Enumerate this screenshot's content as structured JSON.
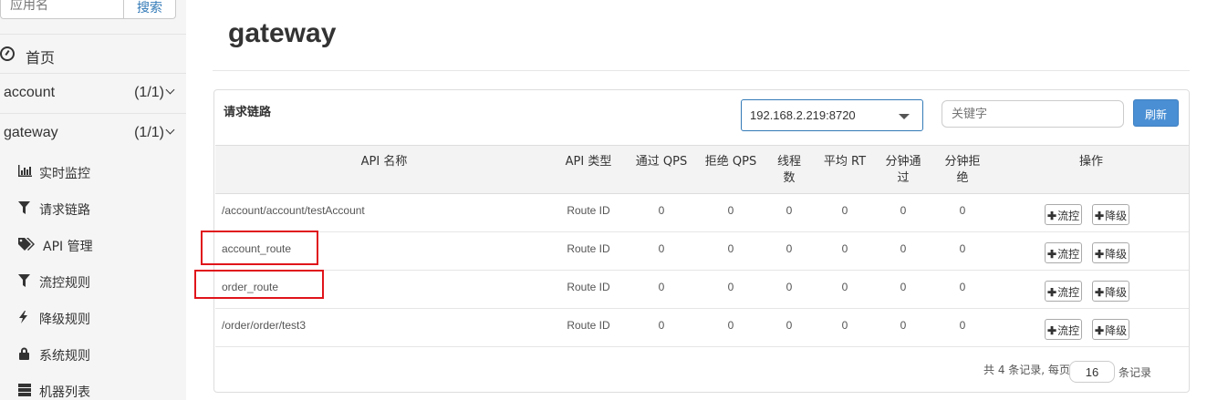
{
  "sidebar": {
    "search": {
      "placeholder": "应用名",
      "button": "搜索"
    },
    "home": {
      "label": "首页",
      "icon": "dashboard-icon"
    },
    "apps": [
      {
        "name": "account",
        "count": "(1/1)"
      },
      {
        "name": "gateway",
        "count": "(1/1)"
      }
    ],
    "sub_items": [
      {
        "label": "实时监控",
        "icon": "bar-chart-icon"
      },
      {
        "label": "请求链路",
        "icon": "filter-icon"
      },
      {
        "label": "API 管理",
        "icon": "tags-icon"
      },
      {
        "label": "流控规则",
        "icon": "filter-icon"
      },
      {
        "label": "降级规则",
        "icon": "flash-icon"
      },
      {
        "label": "系统规则",
        "icon": "lock-icon"
      },
      {
        "label": "机器列表",
        "icon": "server-icon"
      }
    ]
  },
  "main": {
    "title": "gateway",
    "panel": {
      "title": "请求链路",
      "ip_select": "192.168.2.219:8720",
      "keyword_placeholder": "关键字",
      "refresh": "刷新"
    },
    "table": {
      "headers": {
        "api_name": "API 名称",
        "api_type": "API 类型",
        "pass_qps": "通过 QPS",
        "block_qps": "拒绝 QPS",
        "threads_1": "线程",
        "threads_2": "数",
        "avg_rt": "平均 RT",
        "min_pass_1": "分钟通",
        "min_pass_2": "过",
        "min_block_1": "分钟拒",
        "min_block_2": "绝",
        "ops": "操作"
      },
      "rows": [
        {
          "name": "/account/account/testAccount",
          "type": "Route ID",
          "pass_qps": "0",
          "block_qps": "0",
          "threads": "0",
          "avg_rt": "0",
          "min_pass": "0",
          "min_block": "0"
        },
        {
          "name": "account_route",
          "type": "Route ID",
          "pass_qps": "0",
          "block_qps": "0",
          "threads": "0",
          "avg_rt": "0",
          "min_pass": "0",
          "min_block": "0"
        },
        {
          "name": "order_route",
          "type": "Route ID",
          "pass_qps": "0",
          "block_qps": "0",
          "threads": "0",
          "avg_rt": "0",
          "min_pass": "0",
          "min_block": "0"
        },
        {
          "name": "/order/order/test3",
          "type": "Route ID",
          "pass_qps": "0",
          "block_qps": "0",
          "threads": "0",
          "avg_rt": "0",
          "min_pass": "0",
          "min_block": "0"
        }
      ],
      "flow_btn": "流控",
      "degrade_btn": "降级"
    },
    "pager": {
      "before": "共 4 条记录, 每页",
      "page_size": "16",
      "after": "条记录"
    },
    "highlight_color": "#e0141b"
  }
}
